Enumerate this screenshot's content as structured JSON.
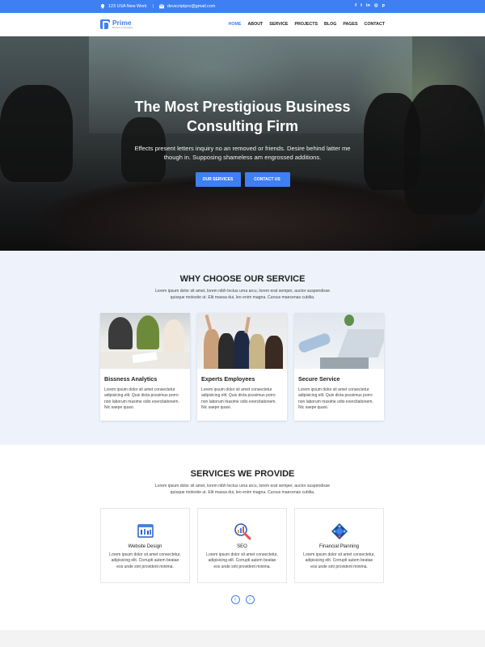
{
  "colors": {
    "accent": "#3e80f1",
    "section_bg": "#eef3fb"
  },
  "topbar": {
    "address": "123 USA New Work",
    "separator": "|",
    "email": "devscriptpro@gmail.com",
    "social": [
      {
        "icon": "facebook-icon",
        "glyph": "f"
      },
      {
        "icon": "twitter-icon",
        "glyph": "t"
      },
      {
        "icon": "linkedin-icon",
        "glyph": "in"
      },
      {
        "icon": "instagram-icon",
        "glyph": "◎"
      },
      {
        "icon": "pinterest-icon",
        "glyph": "p"
      }
    ]
  },
  "nav": {
    "logo_name": "Prime",
    "logo_tagline": "Business & Consulting",
    "items": [
      "HOME",
      "ABOUT",
      "SERVICE",
      "PROJECTS",
      "BLOG",
      "PAGES",
      "CONTACT"
    ]
  },
  "hero": {
    "title_line1": "The Most Prestigious Business",
    "title_line2": "Consulting Firm",
    "text": "Effects present letters inquiry no an removed or friends. Desire behind latter me though in. Supposing shameless am engrossed additions.",
    "button1": "OUR SERVICES",
    "button2": "CONTACT US"
  },
  "why": {
    "title": "WHY CHOOSE OUR SERVICE",
    "subtitle": "Lorem ipsum dolor sit amet, lorem nibh lectus urna arcu, lorem erat semper, auctor suspendisse quisque molestie ut. Elit massa dui, leo enim magna. Cursus maecenas cubilia.",
    "cards": [
      {
        "title": "Bissness Analytics",
        "text": "Lorem ipsum dolor sit amet consectetur adipisicing elit. Quis dicta possimus porro non laborum maxime odio exercitationem. Nic saepe quasi."
      },
      {
        "title": "Experts Employees",
        "text": "Lorem ipsum dolor sit amet consectetur adipisicing elit. Quis dicta possimus porro non laborum maxime odio exercitationem. Nic saepe quasi."
      },
      {
        "title": "Secure Service",
        "text": "Lorem ipsum dolor sit amet consectetur adipisicing elit. Quis dicta possimus porro non laborum maxime odio exercitationem. Nic saepe quasi."
      }
    ]
  },
  "services": {
    "title": "SERVICES WE PROVIDE",
    "subtitle": "Lorem ipsum dolor sit amet, lorem nibh lectus urna arcu, lorem erat semper, auctor suspendisse quisque molestie ut. Elit massa dui, leo enim magna. Cursus maecenas cubilia.",
    "items": [
      {
        "title": "Website Design",
        "icon": "website-design-icon",
        "text": "Lorem ipsum dolor sit amet consectetur, adipisicing elit. Corrupti autem beatae eos unde sint provident minima."
      },
      {
        "title": "SEO",
        "icon": "seo-magnifier-icon",
        "text": "Lorem ipsum dolor sit amet consectetur, adipisicing elit. Corrupti autem beatae eos unde sint provident minima."
      },
      {
        "title": "Financial Planning",
        "icon": "financial-planning-icon",
        "text": "Lorem ipsum dolor sit amet consectetur, adipisicing elit. Corrupti autem beatae eos unde sint provident minima."
      }
    ],
    "prev": "‹",
    "next": "›"
  }
}
